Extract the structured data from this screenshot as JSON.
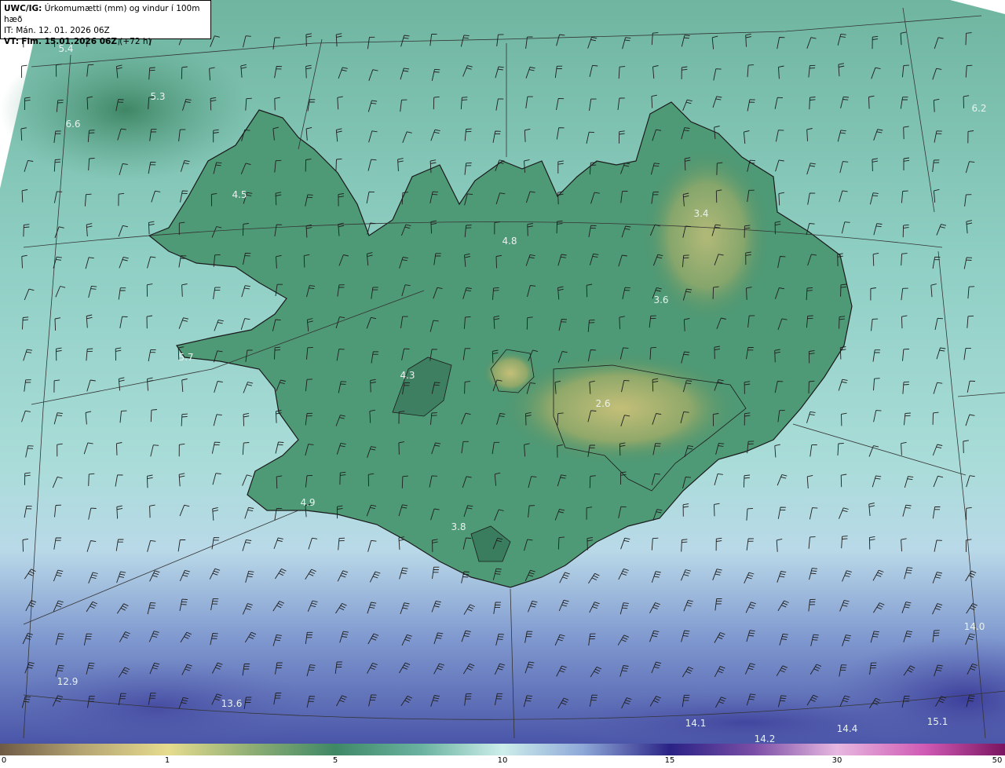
{
  "header": {
    "product": "UWC/IG:",
    "title": "Úrkomumætti (mm) og vindur í 100m hæð",
    "init_time": "IT: Mán. 12. 01. 2026 06Z",
    "valid_prefix": "VT:",
    "valid_time": "Fim. 15.01.2026 06Z",
    "lead": "(+72 h)"
  },
  "colors": {
    "ocean_south": "#4a5fb0",
    "ocean_mid": "#9fd8d6",
    "land_low": "#3f8a66",
    "land_dry": "#b7b86e",
    "coast": "#1a1a1a"
  },
  "value_labels": [
    {
      "text": "5.4"
    },
    {
      "text": "5.3"
    },
    {
      "text": "6.6"
    },
    {
      "text": "4.5"
    },
    {
      "text": "6.2"
    },
    {
      "text": "3.4"
    },
    {
      "text": "4.8"
    },
    {
      "text": "3.6"
    },
    {
      "text": "5.7"
    },
    {
      "text": "4.3"
    },
    {
      "text": "2.6"
    },
    {
      "text": "4.9"
    },
    {
      "text": "3.8"
    },
    {
      "text": "14.0"
    },
    {
      "text": "12.9"
    },
    {
      "text": "13.6"
    },
    {
      "text": "14.1"
    },
    {
      "text": "14.2"
    },
    {
      "text": "14.4"
    },
    {
      "text": "15.1"
    }
  ],
  "colorbar": {
    "ticks": [
      "0",
      "1",
      "5",
      "10",
      "15",
      "30",
      "50"
    ]
  }
}
